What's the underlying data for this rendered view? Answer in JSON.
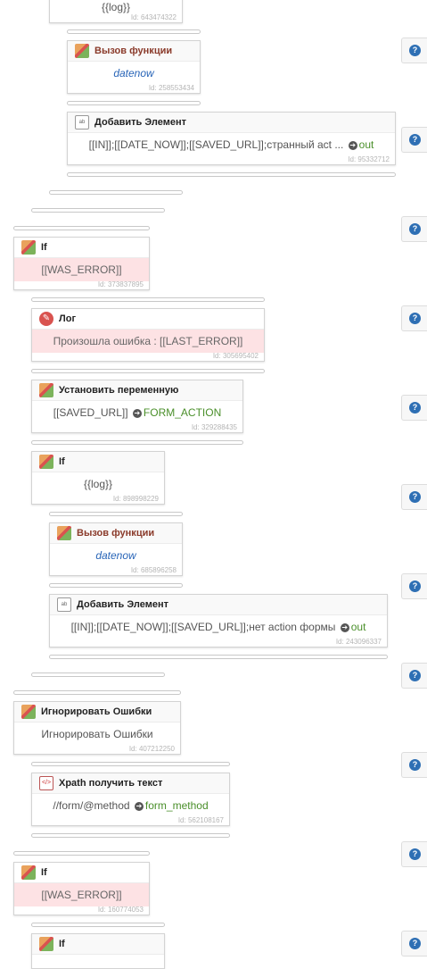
{
  "blocks": [
    {
      "key": "b0",
      "title": "",
      "body": "{{log}}",
      "id": "Id: 643474322",
      "icon": "none"
    },
    {
      "key": "b1",
      "title": "Вызов функции",
      "body": "datenow",
      "id": "Id: 258553434",
      "icon": "function-icon"
    },
    {
      "key": "b2",
      "title": "Добавить Элемент",
      "body": "[[IN]];[[DATE_NOW]];[[SAVED_URL]];странный act ...",
      "out": "out",
      "id": "Id: 95332712",
      "icon": "text-icon"
    },
    {
      "key": "b3",
      "title": "If",
      "body": "[[WAS_ERROR]]",
      "id": "Id: 373837895",
      "icon": "if-icon"
    },
    {
      "key": "b4",
      "title": "Лог",
      "body": "Произошла ошибка : [[LAST_ERROR]]",
      "id": "Id: 305695402",
      "icon": "log-icon"
    },
    {
      "key": "b5",
      "title": "Установить переменную",
      "body": "[[SAVED_URL]]",
      "out": "FORM_ACTION",
      "id": "Id: 329288435",
      "icon": "variable-icon"
    },
    {
      "key": "b6",
      "title": "If",
      "body": "{{log}}",
      "id": "Id: 898998229",
      "icon": "if-icon"
    },
    {
      "key": "b7",
      "title": "Вызов функции",
      "body": "datenow",
      "id": "Id: 685896258",
      "icon": "function-icon"
    },
    {
      "key": "b8",
      "title": "Добавить Элемент",
      "body": "[[IN]];[[DATE_NOW]];[[SAVED_URL]];нет action формы",
      "out": "out",
      "id": "Id: 243096337",
      "icon": "text-icon"
    },
    {
      "key": "b9",
      "title": "Игнорировать Ошибки",
      "body": "Игнорировать Ошибки",
      "id": "Id: 407212250",
      "icon": "ignore-errors-icon"
    },
    {
      "key": "b10",
      "title": "Xpath получить текст",
      "body": "//form/@method",
      "out": "form_method",
      "id": "Id: 562108167",
      "icon": "xpath-icon"
    },
    {
      "key": "b11",
      "title": "If",
      "body": "[[WAS_ERROR]]",
      "id": "Id: 160774053",
      "icon": "if-icon"
    },
    {
      "key": "b12",
      "title": "If",
      "body": "",
      "id": "",
      "icon": "if-icon"
    }
  ],
  "help_symbol": "?",
  "arrow_symbol": "➔",
  "colors": {
    "accent": "#2e6fb4",
    "pink": "#fde2e4",
    "green": "#4a8f2a",
    "function_title": "#8a3a2a"
  }
}
